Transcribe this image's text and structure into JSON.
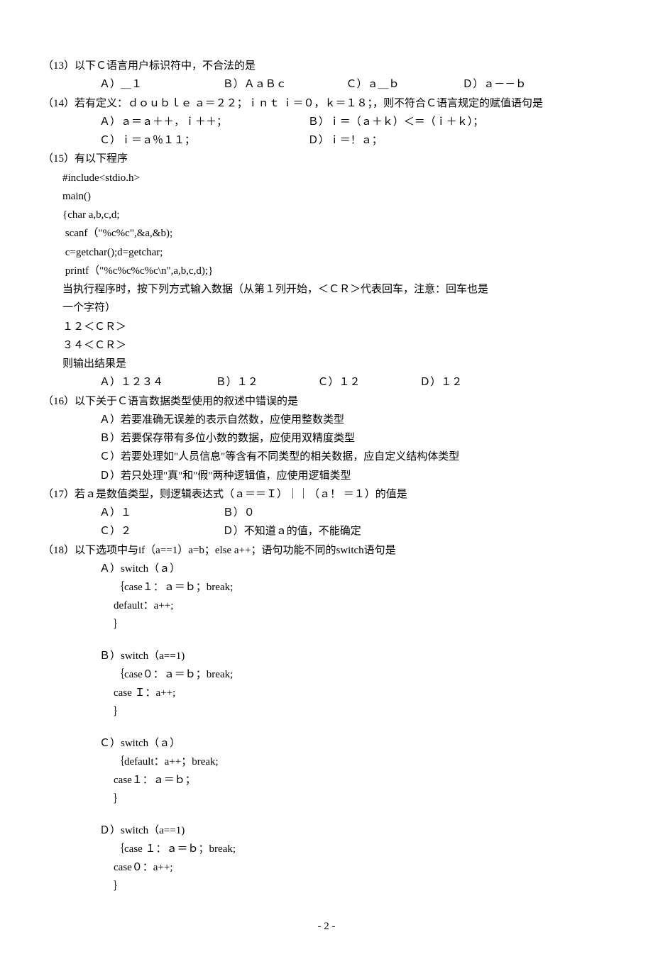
{
  "q13": {
    "text": "（13）以下Ｃ语言用户标识符中，不合法的是",
    "a": "Ａ）＿１",
    "b": "Ｂ）ＡａＢｃ",
    "c": "Ｃ）ａ＿ｂ",
    "d": "Ｄ）ａ－－ｂ"
  },
  "q14": {
    "text": "（14）若有定义：ｄｏｕｂｌｅ ａ＝２２；ｉｎｔ ｉ＝０，ｋ＝１８；，则不符合Ｃ语言规定的赋值语句是",
    "a": "Ａ）ａ＝ａ＋＋，ｉ＋＋；",
    "b": "Ｂ）ｉ＝（ａ＋ｋ）＜＝（ｉ＋ｋ）；",
    "c": "Ｃ）ｉ＝ａ％１１；",
    "d": "Ｄ）ｉ＝！ａ；"
  },
  "q15": {
    "text": "（15）有以下程序",
    "c1": "#include<stdio.h>",
    "c2": "main()",
    "c3": "{char a,b,c,d;",
    "c4": " scanf（\"%c%c\",&a,&b);",
    "c5": " c=getchar();d=getchar;",
    "c6": " printf（\"%c%c%c%c\\n\",a,b,c,d);}",
    "t1": "当执行程序时，按下列方式输入数据（从第１列开始，＜ＣＲ＞代表回车，注意：回车也是",
    "t2": "一个字符）",
    "t3": "１２＜ＣＲ＞",
    "t4": "３４＜ＣＲ＞",
    "t5": "则输出结果是",
    "a": "Ａ）１２３４",
    "b": "Ｂ）１２",
    "c": "Ｃ）１２",
    "d": "Ｄ）１２"
  },
  "q16": {
    "text": "（16）以下关于Ｃ语言数据类型使用的叙述中错误的是",
    "a": "Ａ）若要准确无误差的表示自然数，应使用整数类型",
    "b": "Ｂ）若要保存带有多位小数的数据，应使用双精度类型",
    "c": "Ｃ）若要处理如\"人员信息\"等含有不同类型的相关数据，应自定义结构体类型",
    "d": "Ｄ）若只处理\"真\"和\"假\"两种逻辑值，应使用逻辑类型"
  },
  "q17": {
    "text": "（17）若ａ是数值类型，则逻辑表达式（ａ＝＝Ｉ）｜｜（ａ！ ＝１）的值是",
    "a": "Ａ）１",
    "b": "Ｂ）０",
    "c": "Ｃ）２",
    "d": "Ｄ）不知道ａ的值，不能确定"
  },
  "q18": {
    "text": "（18）以下选项中与if（a==1）a=b；else a++；语句功能不同的switch语句是",
    "a1": "Ａ）switch（ａ）",
    "a2": "｛case１：ａ＝ｂ；break;",
    "a3": "default：a++;",
    "a4": "｝",
    "b1": "Ｂ）switch（a==1)",
    "b2": "｛case０：ａ＝ｂ；break;",
    "b3": "case Ｉ：a++;",
    "b4": "｝",
    "c1": "Ｃ）switch（ａ）",
    "c2": "｛default：a++；break;",
    "c3": "case１：ａ＝ｂ；",
    "c4": "｝",
    "d1": "Ｄ）switch（a==1)",
    "d2": "｛case １：ａ＝ｂ；break;",
    "d3": "case０：a++;",
    "d4": "｝"
  },
  "pagenum": "- 2 -"
}
